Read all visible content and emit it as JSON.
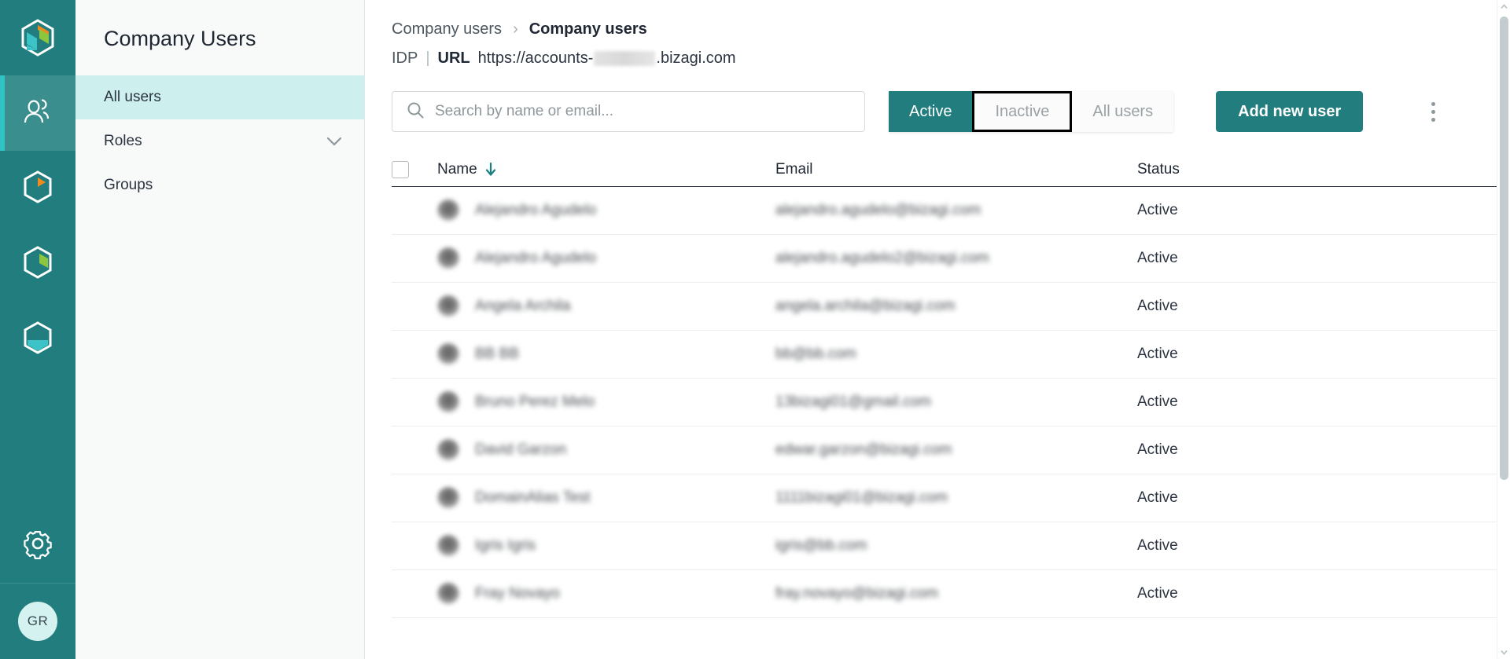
{
  "colors": {
    "teal": "#227e7e",
    "teal_light": "#3b8e8e",
    "accent_cyan": "#2fc3c3",
    "selected_nav": "#cdf0ef",
    "avatar_bg": "#d4f2ef",
    "sort_arrow": "#1a7f7f"
  },
  "rail": {
    "logo_name": "bizagi-hexagon-logo",
    "items": [
      {
        "name": "rail-item-users",
        "icon": "people-icon",
        "active": true
      },
      {
        "name": "rail-item-modeler",
        "icon": "hexagon-orange-icon",
        "active": false
      },
      {
        "name": "rail-item-studio",
        "icon": "hexagon-green-icon",
        "active": false
      },
      {
        "name": "rail-item-automation",
        "icon": "hexagon-cyan-icon",
        "active": false
      }
    ],
    "settings_icon": "gear-icon",
    "avatar_initials": "GR"
  },
  "subnav": {
    "title": "Company Users",
    "items": [
      {
        "label": "All users",
        "selected": true,
        "chevron": false
      },
      {
        "label": "Roles",
        "selected": false,
        "chevron": true
      },
      {
        "label": "Groups",
        "selected": false,
        "chevron": false
      }
    ]
  },
  "breadcrumb": {
    "parent": "Company users",
    "separator": "›",
    "current": "Company users"
  },
  "idp": {
    "label": "IDP",
    "pipe": "|",
    "key": "URL",
    "url_prefix": "https://accounts-",
    "url_suffix": ".bizagi.com",
    "redacted": true
  },
  "toolbar": {
    "search_placeholder": "Search by name or email...",
    "search_value": "",
    "search_icon": "search-icon",
    "filters": [
      {
        "label": "Active",
        "state": "active"
      },
      {
        "label": "Inactive",
        "state": "focused"
      },
      {
        "label": "All users",
        "state": "normal"
      }
    ],
    "add_button": "Add new user",
    "kebab_icon": "more-vertical-icon"
  },
  "table": {
    "columns": [
      {
        "key": "check",
        "label": ""
      },
      {
        "key": "name",
        "label": "Name",
        "sort": "desc",
        "sort_icon": "arrow-down-icon"
      },
      {
        "key": "email",
        "label": "Email"
      },
      {
        "key": "status",
        "label": "Status"
      }
    ],
    "rows": [
      {
        "name": "Alejandro Agudelo",
        "email": "alejandro.agudelo@bizagi.com",
        "status": "Active",
        "redacted": true
      },
      {
        "name": "Alejandro Agudelo",
        "email": "alejandro.agudelo2@bizagi.com",
        "status": "Active",
        "redacted": true
      },
      {
        "name": "Angela Archila",
        "email": "angela.archila@bizagi.com",
        "status": "Active",
        "redacted": true
      },
      {
        "name": "BB BB",
        "email": "bb@bb.com",
        "status": "Active",
        "redacted": true
      },
      {
        "name": "Bruno Perez Melo",
        "email": "13bizagi01@gmail.com",
        "status": "Active",
        "redacted": true
      },
      {
        "name": "David Garzon",
        "email": "edwar.garzon@bizagi.com",
        "status": "Active",
        "redacted": true
      },
      {
        "name": "DomainAlias Test",
        "email": "1111bizagi01@bizagi.com",
        "status": "Active",
        "redacted": true
      },
      {
        "name": "Igris Igris",
        "email": "igris@bb.com",
        "status": "Active",
        "redacted": true
      },
      {
        "name": "Fray Novayo",
        "email": "fray.novayo@bizagi.com",
        "status": "Active",
        "redacted": true
      }
    ]
  },
  "scrollbar": {
    "up_icon": "chevron-up-icon",
    "down_icon": "chevron-down-icon",
    "thumb_name": "scrollbar-thumb"
  }
}
